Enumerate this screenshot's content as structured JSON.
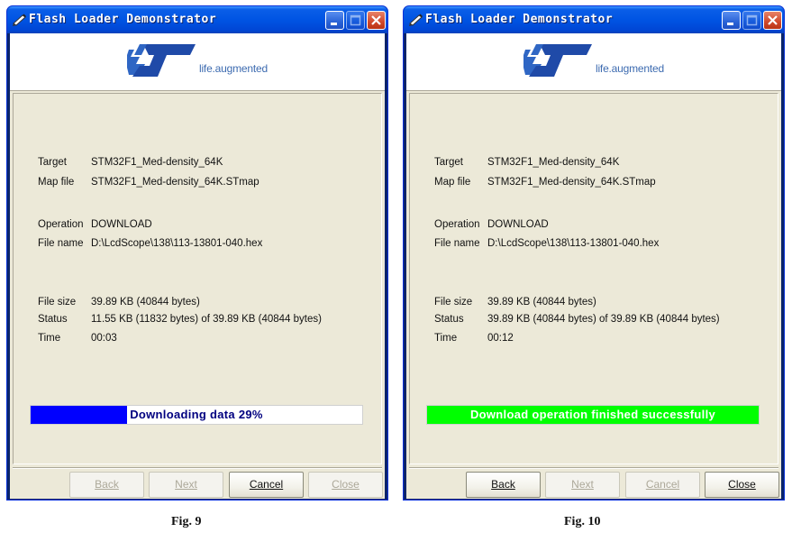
{
  "windows": [
    {
      "title": "Flash Loader Demonstrator",
      "logo_tagline_a": "life",
      "logo_tagline_b": ".augmented",
      "fields": [
        {
          "label": "Target",
          "value": "STM32F1_Med-density_64K"
        },
        {
          "label": "Map file",
          "value": "STM32F1_Med-density_64K.STmap"
        },
        {
          "label": "Operation",
          "value": "DOWNLOAD"
        },
        {
          "label": "File name",
          "value": "D:\\LcdScope\\138\\113-13801-040.hex"
        },
        {
          "label": "File size",
          "value": "39.89 KB (40844 bytes)"
        },
        {
          "label": "Status",
          "value": "11.55 KB (11832 bytes) of 39.89 KB (40844 bytes)"
        },
        {
          "label": "Time",
          "value": "00:03"
        }
      ],
      "progress": {
        "text": "Downloading data 29%",
        "fraction": 0.29,
        "fill_color": "#0000ff",
        "text_color": "#000080"
      },
      "buttons": [
        {
          "label": "Back",
          "enabled": false
        },
        {
          "label": "Next",
          "enabled": false
        },
        {
          "label": "Cancel",
          "enabled": true
        },
        {
          "label": "Close",
          "enabled": false
        }
      ],
      "caption": "Fig. 9"
    },
    {
      "title": "Flash Loader Demonstrator",
      "logo_tagline_a": "life",
      "logo_tagline_b": ".augmented",
      "fields": [
        {
          "label": "Target",
          "value": "STM32F1_Med-density_64K"
        },
        {
          "label": "Map file",
          "value": "STM32F1_Med-density_64K.STmap"
        },
        {
          "label": "Operation",
          "value": "DOWNLOAD"
        },
        {
          "label": "File name",
          "value": "D:\\LcdScope\\138\\113-13801-040.hex"
        },
        {
          "label": "File size",
          "value": "39.89 KB (40844 bytes)"
        },
        {
          "label": "Status",
          "value": "39.89 KB (40844 bytes) of 39.89 KB (40844 bytes)"
        },
        {
          "label": "Time",
          "value": "00:12"
        }
      ],
      "progress": {
        "text": "Download operation finished successfully",
        "fraction": 1.0,
        "fill_color": "#00ff00",
        "text_color": "#ffffff"
      },
      "buttons": [
        {
          "label": "Back",
          "enabled": true
        },
        {
          "label": "Next",
          "enabled": false
        },
        {
          "label": "Cancel",
          "enabled": false
        },
        {
          "label": "Close",
          "enabled": true
        }
      ],
      "caption": "Fig. 10"
    }
  ],
  "colors": {
    "titlebar": "#0054e3",
    "dialog_background": "#ece9d8",
    "logo_blue": "#3d6bb0"
  },
  "icons": {
    "title_icon": "pen-icon",
    "minimize": "minimize-icon",
    "maximize": "maximize-icon",
    "close": "close-icon",
    "logo": "st-logo"
  }
}
